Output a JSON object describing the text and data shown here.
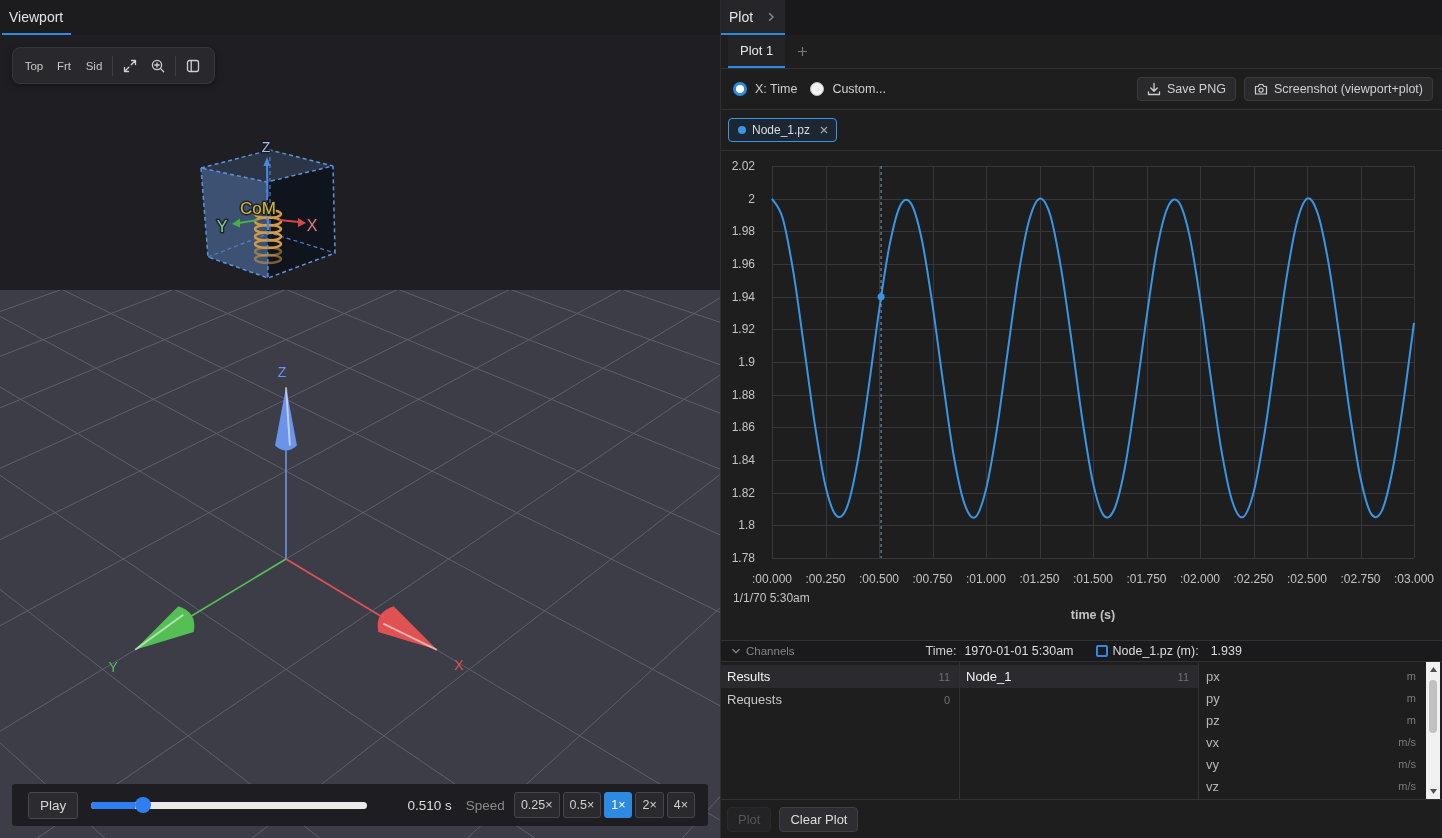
{
  "viewport": {
    "tabs": [
      {
        "label": "Viewport",
        "selected": true
      }
    ],
    "view_buttons": [
      "Top",
      "Frt",
      "Sid"
    ],
    "model_labels": [
      {
        "text": "Z",
        "color": "#a8bce8"
      },
      {
        "text": "Y",
        "color": "#86d486"
      },
      {
        "text": "CoM",
        "color": "#d8b930"
      },
      {
        "text": "X",
        "color": "#e47878"
      }
    ],
    "axis_labels": [
      {
        "text": "Z",
        "color": "#6b93ea"
      },
      {
        "text": "Y",
        "color": "#55bf55"
      },
      {
        "text": "X",
        "color": "#e05252"
      }
    ],
    "playback": {
      "play_label": "Play",
      "level": 0.17,
      "time": "0.510 s",
      "speed_label": "Speed",
      "speeds": [
        {
          "label": "0.25×",
          "selected": false
        },
        {
          "label": "0.5×",
          "selected": false
        },
        {
          "label": "1×",
          "selected": true
        },
        {
          "label": "2×",
          "selected": false
        },
        {
          "label": "4×",
          "selected": false
        }
      ]
    }
  },
  "plot": {
    "tabs": [
      {
        "label": "Plot",
        "selected": true
      }
    ],
    "plot_tabs": [
      {
        "label": "Plot 1",
        "selected": true
      }
    ],
    "x_mode": [
      {
        "label": "X: Time",
        "selected": true
      },
      {
        "label": "Custom...",
        "selected": false
      }
    ],
    "actions": [
      {
        "kind": "download",
        "label": "Save PNG"
      },
      {
        "kind": "camera",
        "label": "Screenshot (viewport+plot)"
      }
    ],
    "chart_data": {
      "type": "line",
      "xlabel": "time (s)",
      "x": [
        0,
        0.05,
        0.1,
        0.15,
        0.2,
        0.25,
        0.3,
        0.35,
        0.4,
        0.45,
        0.5,
        0.55,
        0.6,
        0.65,
        0.7,
        0.75,
        0.8,
        0.85,
        0.9,
        0.95,
        1,
        1.05,
        1.1,
        1.15,
        1.2,
        1.25,
        1.3,
        1.35,
        1.4,
        1.45,
        1.5,
        1.55,
        1.6,
        1.65,
        1.7,
        1.75,
        1.8,
        1.85,
        1.9,
        1.95,
        2,
        2.05,
        2.1,
        2.15,
        2.2,
        2.25,
        2.3,
        2.35,
        2.4,
        2.45,
        2.5,
        2.55,
        2.6,
        2.65,
        2.7,
        2.75,
        2.8,
        2.85,
        2.9,
        2.95,
        3
      ],
      "series": [
        {
          "name": "Node_1.pz",
          "color": "#3896e6",
          "values": [
            2.0,
            1.988,
            1.955,
            1.909,
            1.862,
            1.824,
            1.806,
            1.811,
            1.839,
            1.883,
            1.931,
            1.972,
            1.996,
            1.997,
            1.975,
            1.935,
            1.887,
            1.842,
            1.813,
            1.805,
            1.822,
            1.858,
            1.905,
            1.952,
            1.986,
            2.0,
            1.99,
            1.958,
            1.913,
            1.865,
            1.826,
            1.806,
            1.81,
            1.836,
            1.879,
            1.927,
            1.97,
            1.995,
            1.998,
            1.978,
            1.939,
            1.891,
            1.846,
            1.815,
            1.805,
            1.82,
            1.855,
            1.901,
            1.948,
            1.984,
            2.0,
            1.991,
            1.961,
            1.917,
            1.869,
            1.829,
            1.807,
            1.809,
            1.834,
            1.875,
            1.924
          ]
        }
      ],
      "xlim": [
        0,
        3
      ],
      "ylim": [
        1.78,
        2.02
      ],
      "xticks": [
        {
          "value": 0,
          "label": ":00.000"
        },
        {
          "value": 0.25,
          "label": ":00.250"
        },
        {
          "value": 0.5,
          "label": ":00.500"
        },
        {
          "value": 0.75,
          "label": ":00.750"
        },
        {
          "value": 1,
          "label": ":01.000"
        },
        {
          "value": 1.25,
          "label": ":01.250"
        },
        {
          "value": 1.5,
          "label": ":01.500"
        },
        {
          "value": 1.75,
          "label": ":01.750"
        },
        {
          "value": 2,
          "label": ":02.000"
        },
        {
          "value": 2.25,
          "label": ":02.250"
        },
        {
          "value": 2.5,
          "label": ":02.500"
        },
        {
          "value": 2.75,
          "label": ":02.750"
        },
        {
          "value": 3,
          "label": ":03.000"
        }
      ],
      "yticks": [
        1.78,
        1.8,
        1.82,
        1.84,
        1.86,
        1.88,
        1.9,
        1.92,
        1.94,
        1.96,
        1.98,
        2,
        2.02
      ],
      "grid": true,
      "ref_lines": [
        {
          "axis": "x",
          "value": 0.51
        }
      ]
    },
    "date_label": "1/1/70 5:30am"
  },
  "channels": {
    "title": "Channels",
    "expanded": true,
    "time_label": "Time:",
    "time_value": "1970-01-01 5:30am",
    "readout": {
      "checked": false,
      "label": "Node_1.pz (m):",
      "value": "1.939"
    },
    "groups": [
      {
        "name": "Results",
        "count": "11",
        "selected": true
      },
      {
        "name": "Requests",
        "count": "0",
        "selected": false
      }
    ],
    "nodes": [
      {
        "name": "Node_1",
        "count": "11",
        "selected": true
      }
    ],
    "signals": [
      {
        "name": "px",
        "unit": "m",
        "selected": false
      },
      {
        "name": "py",
        "unit": "m",
        "selected": false
      },
      {
        "name": "pz",
        "unit": "m",
        "selected": false
      },
      {
        "name": "vx",
        "unit": "m/s",
        "selected": false
      },
      {
        "name": "vy",
        "unit": "m/s",
        "selected": false
      },
      {
        "name": "vz",
        "unit": "m/s",
        "selected": false
      }
    ],
    "actions": [
      {
        "label": "Plot",
        "disabled": true
      },
      {
        "label": "Clear Plot",
        "disabled": false
      }
    ]
  }
}
